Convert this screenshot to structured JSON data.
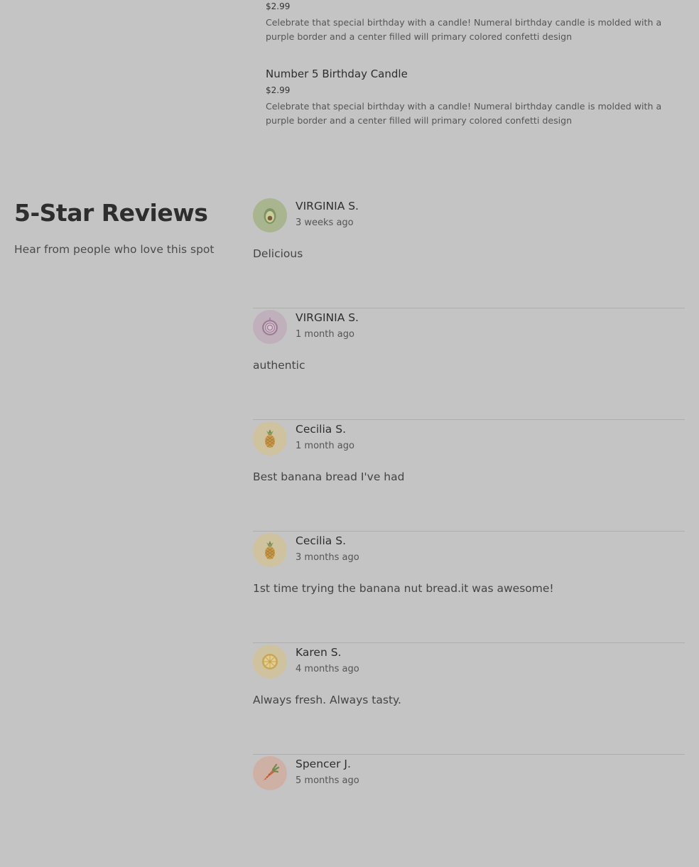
{
  "products": [
    {
      "name": "",
      "price": "$2.99",
      "description": "Celebrate that special birthday with a candle! Numeral birthday candle is molded with a purple border and a center filled will primary colored confetti design"
    },
    {
      "name": "Number 5 Birthday Candle",
      "price": "$2.99",
      "description": "Celebrate that special birthday with a candle! Numeral birthday candle is molded with a purple border and a center filled will primary colored confetti design"
    }
  ],
  "reviews_section": {
    "title": "5-Star Reviews",
    "subtitle": "Hear from people who love this spot"
  },
  "reviews": [
    {
      "name": "VIRGINIA S.",
      "time": "3 weeks ago",
      "text": "Delicious",
      "avatar_icon": "avocado-icon",
      "avatar_bg": "#a8b58f"
    },
    {
      "name": "VIRGINIA S.",
      "time": "1 month ago",
      "text": "authentic",
      "avatar_icon": "onion-icon",
      "avatar_bg": "#bfb0bb"
    },
    {
      "name": "Cecilia S.",
      "time": "1 month ago",
      "text": "Best banana bread I've had",
      "avatar_icon": "pineapple-icon",
      "avatar_bg": "#cfc29f"
    },
    {
      "name": "Cecilia S.",
      "time": "3 months ago",
      "text": "1st time trying the banana nut bread.it was awesome!",
      "avatar_icon": "pineapple-icon",
      "avatar_bg": "#cfc29f"
    },
    {
      "name": "Karen S.",
      "time": "4 months ago",
      "text": "Always fresh. Always tasty.",
      "avatar_icon": "lemon-icon",
      "avatar_bg": "#cfc29f"
    },
    {
      "name": "Spencer J.",
      "time": "5 months ago",
      "text": "",
      "avatar_icon": "carrot-icon",
      "avatar_bg": "#cfb0a5"
    }
  ]
}
